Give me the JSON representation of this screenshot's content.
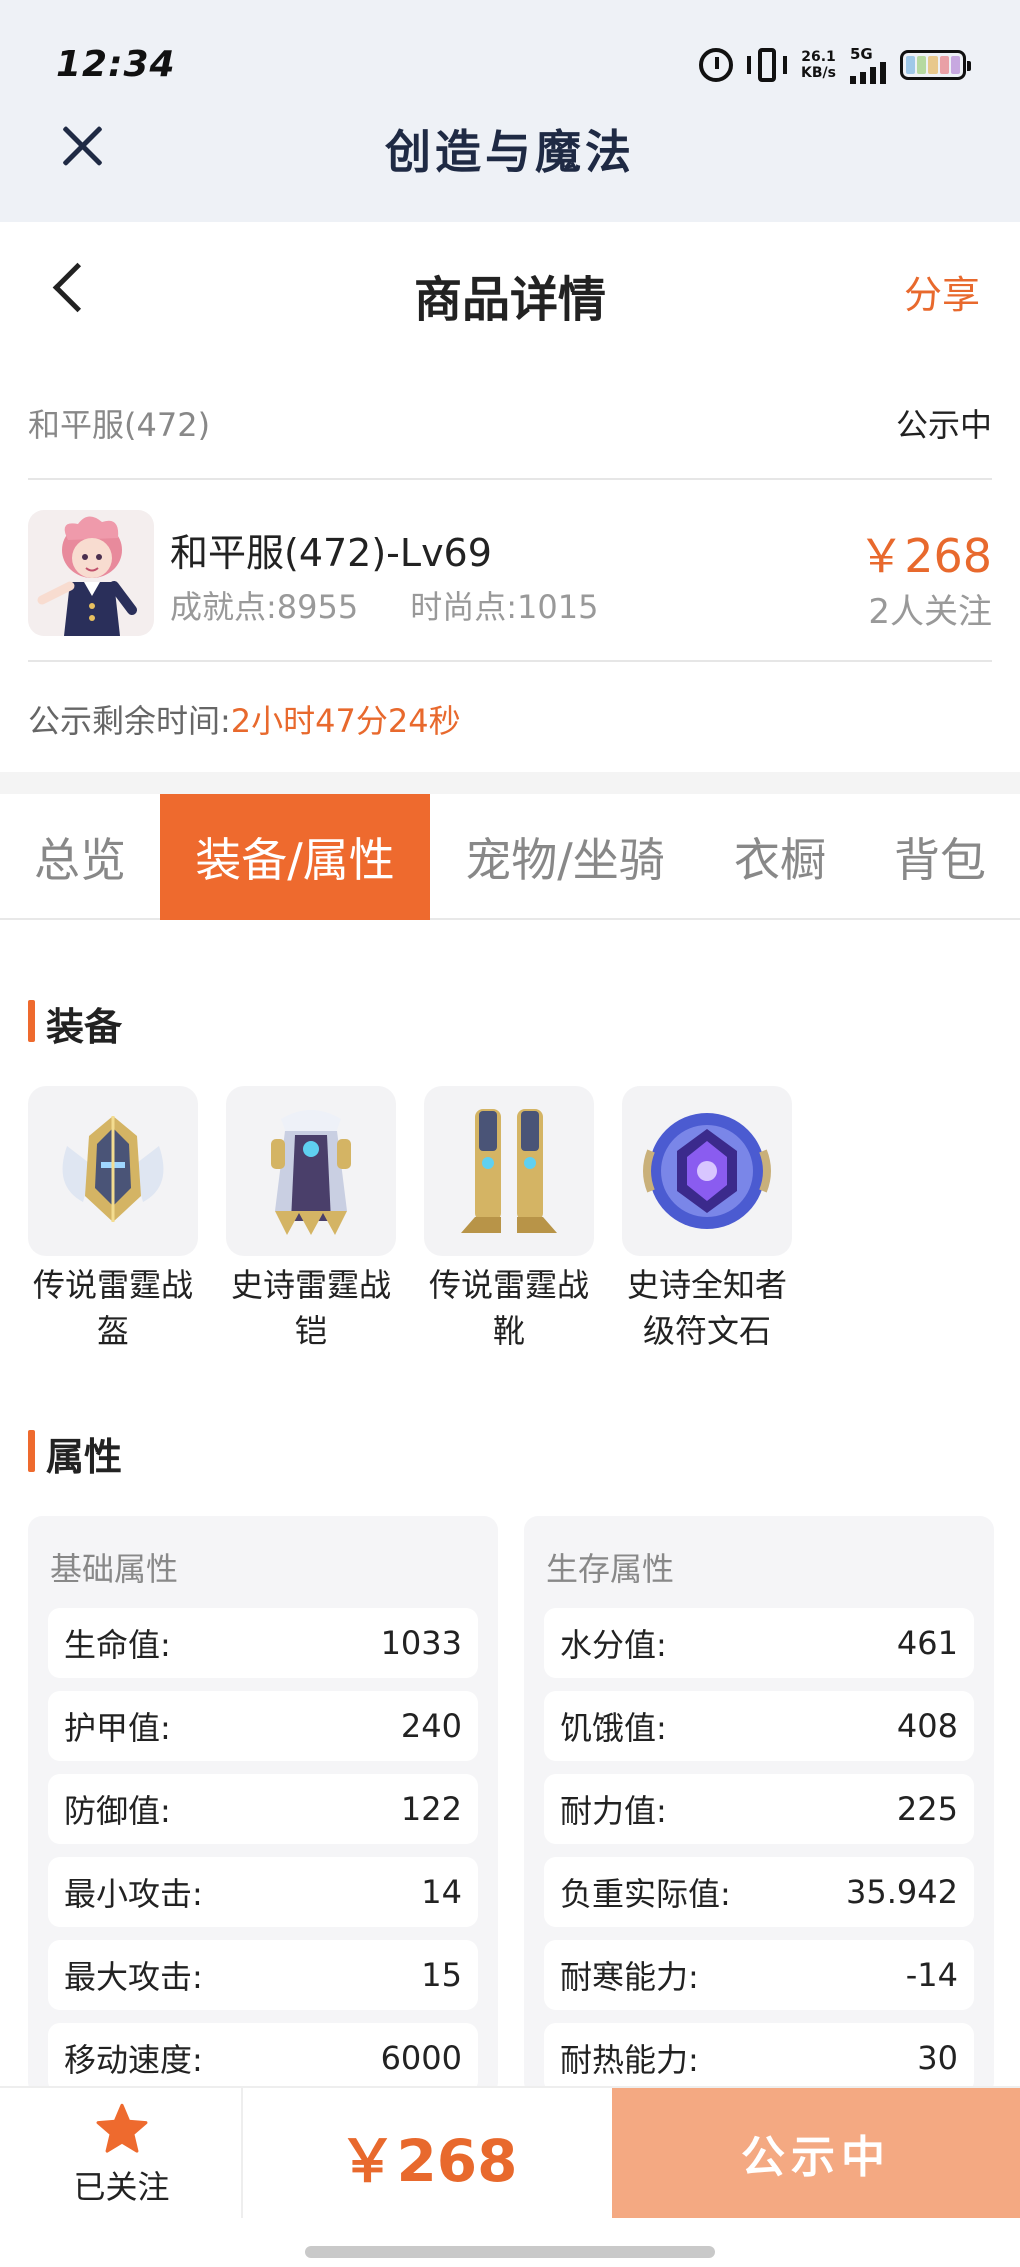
{
  "status_bar": {
    "time": "12:34",
    "net_speed": "26.1",
    "net_unit": "KB/s",
    "network": "5G",
    "icons": [
      "alarm-icon",
      "vibrate-icon",
      "signal-icon",
      "battery-icon"
    ]
  },
  "app_bar": {
    "title": "创造与魔法",
    "close_icon": "close-icon"
  },
  "header": {
    "title": "商品详情",
    "share_label": "分享",
    "back_icon": "back-arrow-icon"
  },
  "server": {
    "name": "和平服(472)",
    "status": "公示中"
  },
  "item": {
    "name": "和平服(472)-Lv69",
    "achievement": "成就点:8955",
    "fashion": "时尚点:1015",
    "price": "￥268",
    "followers": "2人关注"
  },
  "countdown": {
    "label": "公示剩余时间:",
    "value": "2小时47分24秒"
  },
  "tabs": [
    {
      "label": "总览",
      "active": false
    },
    {
      "label": "装备/属性",
      "active": true
    },
    {
      "label": "宠物/坐骑",
      "active": false
    },
    {
      "label": "衣橱",
      "active": false
    },
    {
      "label": "背包",
      "active": false
    }
  ],
  "equipment": {
    "title": "装备",
    "items": [
      {
        "line1": "传说雷霆战",
        "line2": "盔",
        "icon": "helmet-icon"
      },
      {
        "line1": "史诗雷霆战",
        "line2": "铠",
        "icon": "armor-icon"
      },
      {
        "line1": "传说雷霆战",
        "line2": "靴",
        "icon": "boots-icon"
      },
      {
        "line1": "史诗全知者",
        "line2": "级符文石",
        "icon": "rune-stone-icon"
      }
    ]
  },
  "attributes": {
    "title": "属性",
    "basic": {
      "title": "基础属性",
      "rows": [
        {
          "label": "生命值:",
          "value": "1033"
        },
        {
          "label": "护甲值:",
          "value": "240"
        },
        {
          "label": "防御值:",
          "value": "122"
        },
        {
          "label": "最小攻击:",
          "value": "14"
        },
        {
          "label": "最大攻击:",
          "value": "15"
        },
        {
          "label": "移动速度:",
          "value": "6000"
        }
      ]
    },
    "survival": {
      "title": "生存属性",
      "rows": [
        {
          "label": "水分值:",
          "value": "461"
        },
        {
          "label": "饥饿值:",
          "value": "408"
        },
        {
          "label": "耐力值:",
          "value": "225"
        },
        {
          "label": "负重实际值:",
          "value": "35.942"
        },
        {
          "label": "耐寒能力:",
          "value": "-14"
        },
        {
          "label": "耐热能力:",
          "value": "30"
        }
      ]
    }
  },
  "bottom_bar": {
    "follow_label": "已关注",
    "price": "￥268",
    "action_label": "公示中"
  },
  "colors": {
    "accent": "#ee6a2e",
    "price": "#e8692d",
    "button_disabled": "#f4a982"
  }
}
